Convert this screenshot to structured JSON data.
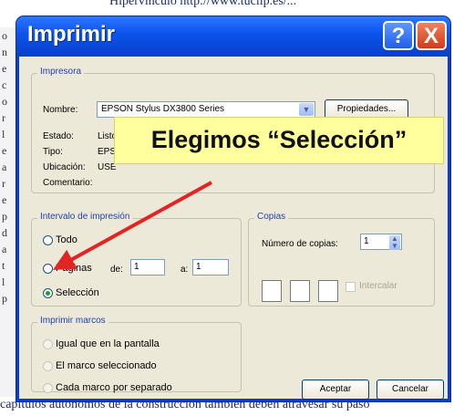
{
  "background": {
    "top_text": "Hipervínculo http://www.tuclip.es/...",
    "bottom_text": "capítulos autónomos de la construcción también deben atravesar su paso",
    "margin_letters": [
      "o",
      "n",
      "e",
      "c",
      "o",
      "r",
      "l",
      "e",
      "a",
      "r",
      "e",
      "p",
      "d",
      "a",
      "t",
      "l",
      "p"
    ]
  },
  "window": {
    "title": "Imprimir",
    "help_label": "?",
    "close_label": "X"
  },
  "printer": {
    "group_label": "Impresora",
    "name_label": "Nombre:",
    "name_value": "EPSON Stylus DX3800 Series",
    "properties_button": "Propiedades...",
    "status_label": "Estado:",
    "status_value": "Listo",
    "type_label": "Tipo:",
    "type_value": "EPS",
    "location_label": "Ubicación:",
    "location_value": "USE",
    "comment_label": "Comentario:"
  },
  "range": {
    "group_label": "Intervalo de impresión",
    "all_label": "Todo",
    "pages_label": "Páginas",
    "from_label": "de:",
    "from_value": "1",
    "to_label": "a:",
    "to_value": "1",
    "selection_label": "Selección",
    "selected": "selection"
  },
  "copies": {
    "group_label": "Copias",
    "count_label": "Número de copias:",
    "count_value": "1",
    "collate_label": "Intercalar"
  },
  "frames": {
    "group_label": "Imprimir marcos",
    "option1": "Igual que en la pantalla",
    "option2": "El marco seleccionado",
    "option3": "Cada marco por separado"
  },
  "buttons": {
    "ok": "Aceptar",
    "cancel": "Cancelar"
  },
  "callout": {
    "text": "Elegimos “Selección”"
  },
  "colors": {
    "titlebar": "#0a48d8",
    "dialog_bg": "#ece9d8",
    "callout_bg": "#ffff9e",
    "arrow": "#e32424"
  }
}
